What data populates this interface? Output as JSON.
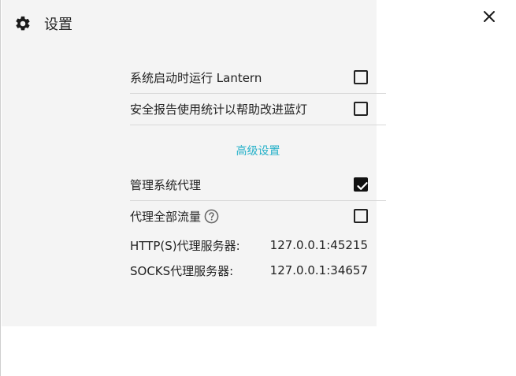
{
  "header": {
    "title": "设置",
    "icon": "gear-icon"
  },
  "close": {
    "icon": "close-icon"
  },
  "settings": {
    "run_at_startup": {
      "label": "系统启动时运行 Lantern",
      "checked": false
    },
    "send_stats": {
      "label": "安全报告使用统计以帮助改进蓝灯",
      "checked": false
    }
  },
  "advanced": {
    "link_label": "高级设置",
    "manage_proxy": {
      "label": "管理系统代理",
      "checked": true
    },
    "proxy_all": {
      "label": "代理全部流量",
      "checked": false,
      "help_icon": "question-circle-icon"
    },
    "http_proxy": {
      "label": "HTTP(S)代理服务器:",
      "value": "127.0.0.1:45215"
    },
    "socks_proxy": {
      "label": "SOCKS代理服务器:",
      "value": "127.0.0.1:34657"
    }
  },
  "colors": {
    "accent": "#26b1c9",
    "panel_bg": "#f4f4f4",
    "text": "#222222"
  }
}
